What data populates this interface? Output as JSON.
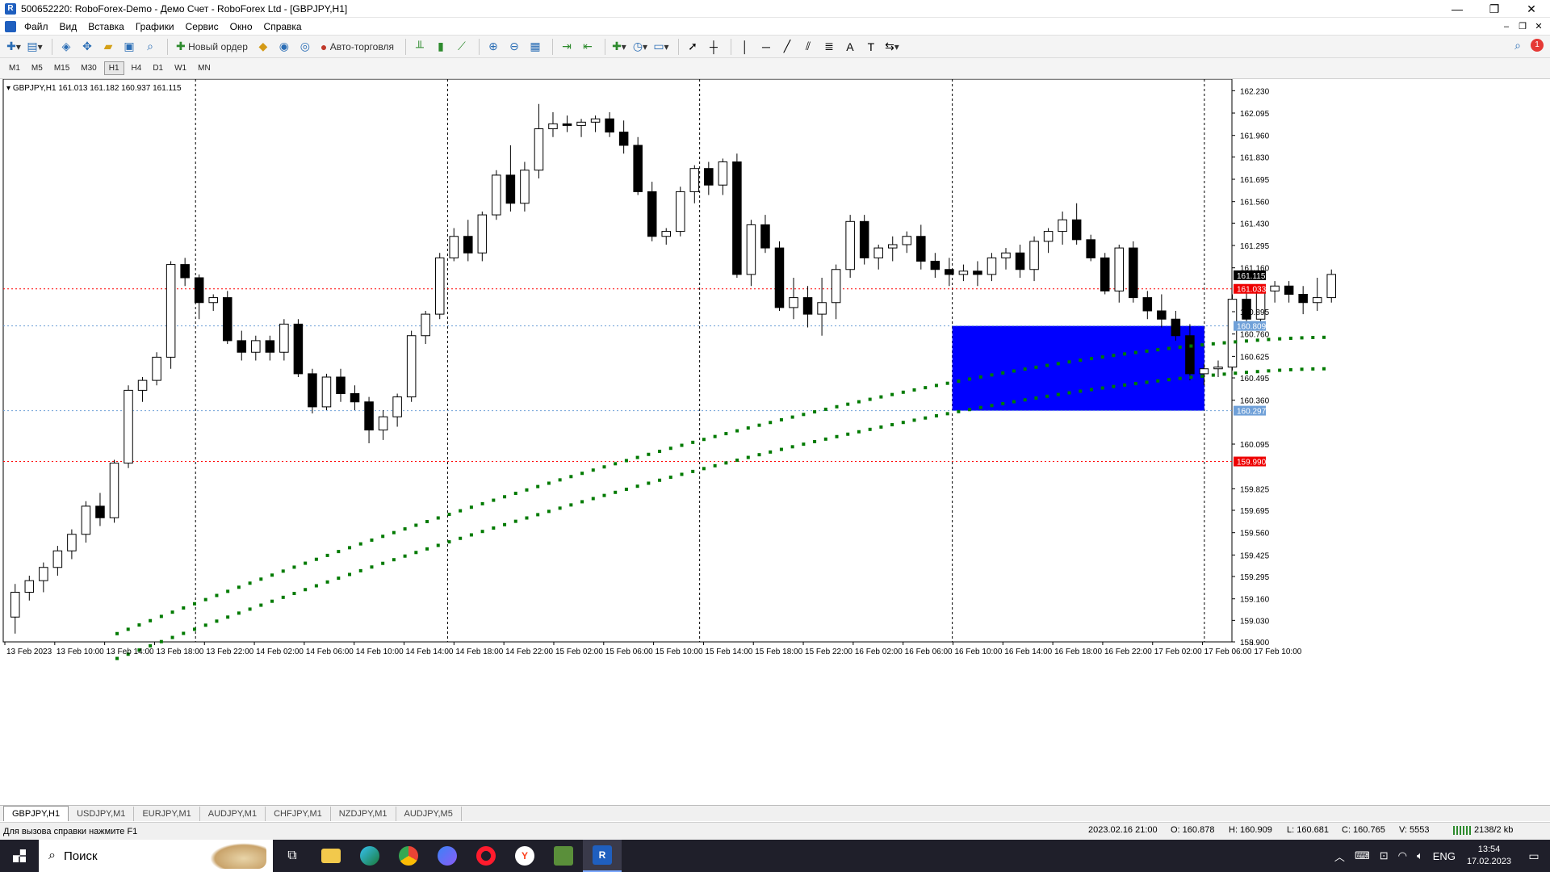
{
  "window": {
    "title": "500652220: RoboForex-Demo - Демо Счет - RoboForex Ltd - [GBPJPY,H1]",
    "controls": [
      "—",
      "❐",
      "✕"
    ]
  },
  "menu": {
    "items": [
      "Файл",
      "Вид",
      "Вставка",
      "Графики",
      "Сервис",
      "Окно",
      "Справка"
    ],
    "mdi_controls": [
      "–",
      "❐",
      "✕"
    ]
  },
  "toolbar": {
    "new_order_label": "Новый ордер",
    "auto_trading_label": "Авто-торговля"
  },
  "timeframes": {
    "items": [
      "M1",
      "M5",
      "M15",
      "M30",
      "H1",
      "H4",
      "D1",
      "W1",
      "MN"
    ],
    "active": "H1"
  },
  "chart": {
    "header": "GBPJPY,H1  161.013 161.182 160.937 161.115",
    "price_labels": [
      "162.230",
      "162.095",
      "161.960",
      "161.830",
      "161.695",
      "161.560",
      "161.430",
      "161.295",
      "161.160",
      "160.895",
      "160.760",
      "160.625",
      "160.495",
      "160.360",
      "160.095",
      "159.825",
      "159.695",
      "159.560",
      "159.425",
      "159.295",
      "159.160",
      "159.030",
      "158.900"
    ],
    "current_price": "161.115",
    "red_level_1": "161.033",
    "red_level_2": "159.990",
    "blue_level_1": "160.809",
    "blue_level_2": "160.297",
    "time_labels": [
      "13 Feb 2023",
      "13 Feb 10:00",
      "13 Feb 14:00",
      "13 Feb 18:00",
      "13 Feb 22:00",
      "14 Feb 02:00",
      "14 Feb 06:00",
      "14 Feb 10:00",
      "14 Feb 14:00",
      "14 Feb 18:00",
      "14 Feb 22:00",
      "15 Feb 02:00",
      "15 Feb 06:00",
      "15 Feb 10:00",
      "15 Feb 14:00",
      "15 Feb 18:00",
      "15 Feb 22:00",
      "16 Feb 02:00",
      "16 Feb 06:00",
      "16 Feb 10:00",
      "16 Feb 14:00",
      "16 Feb 18:00",
      "16 Feb 22:00",
      "17 Feb 02:00",
      "17 Feb 06:00",
      "17 Feb 10:00"
    ],
    "colors": {
      "rect": "#0000ff",
      "dots": "#007a00",
      "red_line": "#ff0000",
      "blue_line": "#6fa0d8"
    }
  },
  "chart_data": {
    "type": "candlestick",
    "symbol": "GBPJPY",
    "timeframe": "H1",
    "ylim": [
      158.9,
      162.3
    ],
    "candles": [
      [
        159.05,
        159.25,
        158.95,
        159.2
      ],
      [
        159.2,
        159.3,
        159.15,
        159.27
      ],
      [
        159.27,
        159.38,
        159.2,
        159.35
      ],
      [
        159.35,
        159.48,
        159.3,
        159.45
      ],
      [
        159.45,
        159.58,
        159.4,
        159.55
      ],
      [
        159.55,
        159.75,
        159.5,
        159.72
      ],
      [
        159.72,
        159.8,
        159.6,
        159.65
      ],
      [
        159.65,
        160.0,
        159.62,
        159.98
      ],
      [
        159.98,
        160.45,
        159.95,
        160.42
      ],
      [
        160.42,
        160.5,
        160.35,
        160.48
      ],
      [
        160.48,
        160.65,
        160.45,
        160.62
      ],
      [
        160.62,
        161.2,
        160.55,
        161.18
      ],
      [
        161.18,
        161.22,
        161.05,
        161.1
      ],
      [
        161.1,
        161.12,
        160.85,
        160.95
      ],
      [
        160.95,
        161.0,
        160.9,
        160.98
      ],
      [
        160.98,
        161.02,
        160.7,
        160.72
      ],
      [
        160.72,
        160.78,
        160.6,
        160.65
      ],
      [
        160.65,
        160.75,
        160.6,
        160.72
      ],
      [
        160.72,
        160.75,
        160.6,
        160.65
      ],
      [
        160.65,
        160.85,
        160.6,
        160.82
      ],
      [
        160.82,
        160.85,
        160.5,
        160.52
      ],
      [
        160.52,
        160.55,
        160.28,
        160.32
      ],
      [
        160.32,
        160.52,
        160.3,
        160.5
      ],
      [
        160.5,
        160.55,
        160.35,
        160.4
      ],
      [
        160.4,
        160.45,
        160.3,
        160.35
      ],
      [
        160.35,
        160.38,
        160.1,
        160.18
      ],
      [
        160.18,
        160.3,
        160.12,
        160.26
      ],
      [
        160.26,
        160.4,
        160.2,
        160.38
      ],
      [
        160.38,
        160.78,
        160.35,
        160.75
      ],
      [
        160.75,
        160.9,
        160.7,
        160.88
      ],
      [
        160.88,
        161.25,
        160.85,
        161.22
      ],
      [
        161.22,
        161.4,
        161.2,
        161.35
      ],
      [
        161.35,
        161.45,
        161.2,
        161.25
      ],
      [
        161.25,
        161.5,
        161.2,
        161.48
      ],
      [
        161.48,
        161.75,
        161.45,
        161.72
      ],
      [
        161.72,
        161.9,
        161.5,
        161.55
      ],
      [
        161.55,
        161.8,
        161.5,
        161.75
      ],
      [
        161.75,
        162.15,
        161.7,
        162.0
      ],
      [
        162.0,
        162.1,
        161.95,
        162.03
      ],
      [
        162.03,
        162.08,
        161.98,
        162.02
      ],
      [
        162.02,
        162.06,
        161.95,
        162.04
      ],
      [
        162.04,
        162.08,
        161.98,
        162.06
      ],
      [
        162.06,
        162.1,
        161.95,
        161.98
      ],
      [
        161.98,
        162.05,
        161.85,
        161.9
      ],
      [
        161.9,
        161.95,
        161.6,
        161.62
      ],
      [
        161.62,
        161.68,
        161.32,
        161.35
      ],
      [
        161.35,
        161.4,
        161.3,
        161.38
      ],
      [
        161.38,
        161.65,
        161.35,
        161.62
      ],
      [
        161.62,
        161.78,
        161.55,
        161.76
      ],
      [
        161.76,
        161.8,
        161.6,
        161.66
      ],
      [
        161.66,
        161.82,
        161.6,
        161.8
      ],
      [
        161.8,
        161.85,
        161.1,
        161.12
      ],
      [
        161.12,
        161.45,
        161.05,
        161.42
      ],
      [
        161.42,
        161.48,
        161.25,
        161.28
      ],
      [
        161.28,
        161.32,
        160.9,
        160.92
      ],
      [
        160.92,
        161.1,
        160.85,
        160.98
      ],
      [
        160.98,
        161.05,
        160.8,
        160.88
      ],
      [
        160.88,
        161.1,
        160.75,
        160.95
      ],
      [
        160.95,
        161.18,
        160.85,
        161.15
      ],
      [
        161.15,
        161.48,
        161.1,
        161.44
      ],
      [
        161.44,
        161.48,
        161.18,
        161.22
      ],
      [
        161.22,
        161.3,
        161.15,
        161.28
      ],
      [
        161.28,
        161.35,
        161.2,
        161.3
      ],
      [
        161.3,
        161.38,
        161.25,
        161.35
      ],
      [
        161.35,
        161.42,
        161.15,
        161.2
      ],
      [
        161.2,
        161.25,
        161.1,
        161.15
      ],
      [
        161.15,
        161.22,
        161.05,
        161.12
      ],
      [
        161.12,
        161.18,
        161.08,
        161.14
      ],
      [
        161.14,
        161.2,
        161.05,
        161.12
      ],
      [
        161.12,
        161.25,
        161.08,
        161.22
      ],
      [
        161.22,
        161.28,
        161.15,
        161.25
      ],
      [
        161.25,
        161.3,
        161.1,
        161.15
      ],
      [
        161.15,
        161.35,
        161.08,
        161.32
      ],
      [
        161.32,
        161.4,
        161.25,
        161.38
      ],
      [
        161.38,
        161.5,
        161.3,
        161.45
      ],
      [
        161.45,
        161.55,
        161.3,
        161.33
      ],
      [
        161.33,
        161.36,
        161.2,
        161.22
      ],
      [
        161.22,
        161.25,
        161.0,
        161.02
      ],
      [
        161.02,
        161.3,
        160.95,
        161.28
      ],
      [
        161.28,
        161.32,
        160.95,
        160.98
      ],
      [
        160.98,
        161.02,
        160.85,
        160.9
      ],
      [
        160.9,
        161.0,
        160.8,
        160.85
      ],
      [
        160.85,
        160.9,
        160.72,
        160.75
      ],
      [
        160.75,
        160.82,
        160.48,
        160.52
      ],
      [
        160.52,
        160.58,
        160.45,
        160.55
      ],
      [
        160.55,
        160.6,
        160.5,
        160.56
      ],
      [
        160.56,
        161.0,
        160.54,
        160.97
      ],
      [
        160.97,
        161.02,
        160.8,
        160.85
      ],
      [
        160.85,
        161.05,
        160.82,
        161.02
      ],
      [
        161.02,
        161.08,
        160.95,
        161.05
      ],
      [
        161.05,
        161.08,
        160.95,
        161.0
      ],
      [
        161.0,
        161.05,
        160.88,
        160.95
      ],
      [
        160.95,
        161.1,
        160.9,
        160.98
      ],
      [
        160.98,
        161.15,
        160.95,
        161.12
      ]
    ]
  },
  "chart_tabs": [
    "GBPJPY,H1",
    "USDJPY,M1",
    "EURJPY,M1",
    "AUDJPY,M1",
    "CHFJPY,M1",
    "NZDJPY,M1",
    "AUDJPY,M5"
  ],
  "status": {
    "help": "Для вызова справки нажмите F1",
    "datetime": "2023.02.16 21:00",
    "open": "O: 160.878",
    "high": "H: 160.909",
    "low": "L: 160.681",
    "close": "C: 160.765",
    "volume": "V: 5553",
    "traffic": "2138/2 kb"
  },
  "taskbar": {
    "search_placeholder": "Поиск",
    "lang": "ENG",
    "time": "13:54",
    "date": "17.02.2023"
  }
}
